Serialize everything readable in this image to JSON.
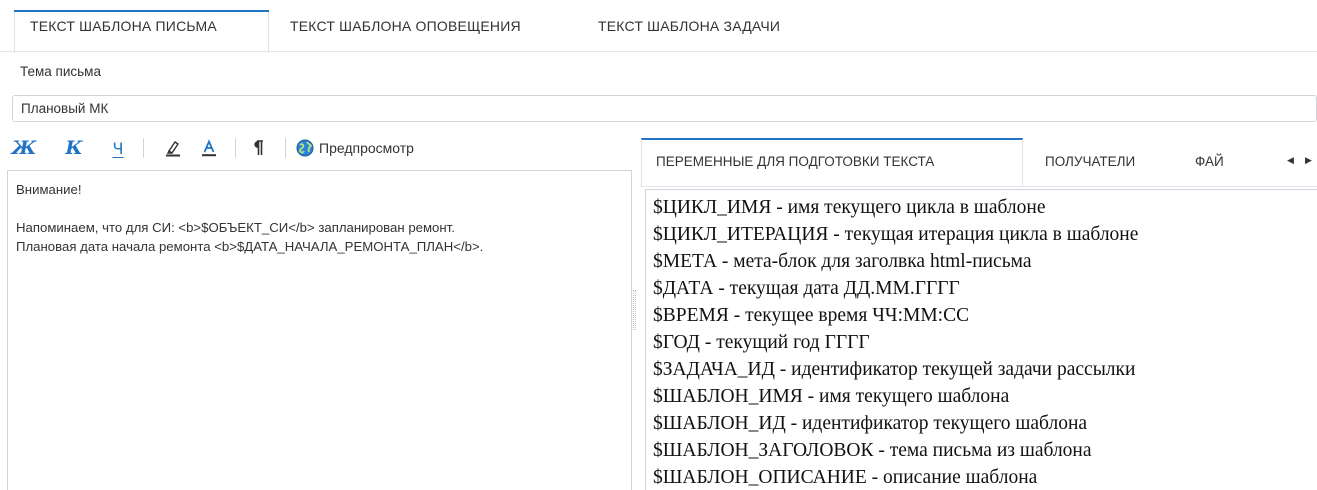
{
  "top_tabs": [
    {
      "label": "ТЕКСТ ШАБЛОНА ПИСЬМА",
      "active": true
    },
    {
      "label": "ТЕКСТ ШАБЛОНА ОПОВЕЩЕНИЯ",
      "active": false
    },
    {
      "label": "ТЕКСТ ШАБЛОНА ЗАДАЧИ",
      "active": false
    }
  ],
  "subject": {
    "label": "Тема письма",
    "value": "Плановый МК"
  },
  "toolbar": {
    "bold_label": "Ж",
    "italic_label": "К",
    "underline_label": "Ч",
    "preview_label": "Предпросмотр",
    "icons": [
      "bold-icon",
      "italic-icon",
      "underline-icon",
      "highlight-icon",
      "text-color-icon",
      "pilcrow-icon",
      "globe-icon"
    ],
    "accent_color": "#1f74c4"
  },
  "editor": {
    "content": "Внимание!\n\nНапоминаем, что для СИ: <b>$ОБЪЕКТ_СИ</b> запланирован ремонт.\nПлановая дата начала ремонта <b>$ДАТА_НАЧАЛА_РЕМОНТА_ПЛАН</b>."
  },
  "right_tabs": [
    {
      "label": "ПЕРЕМЕННЫЕ ДЛЯ ПОДГОТОВКИ ТЕКСТА",
      "active": true
    },
    {
      "label": "ПОЛУЧАТЕЛИ",
      "active": false
    },
    {
      "label": "ФАЙ",
      "active": false
    }
  ],
  "tab_scroll": {
    "left": "◀",
    "right": "▶"
  },
  "variables": [
    "$ЦИКЛ_ИМЯ - имя текущего цикла в шаблоне",
    "$ЦИКЛ_ИТЕРАЦИЯ - текущая итерация цикла в шаблоне",
    "$МЕТА - мета-блок для заголвка html-письма",
    "$ДАТА - текущая дата ДД.ММ.ГГГГ",
    "$ВРЕМЯ - текущее время ЧЧ:ММ:СС",
    "$ГОД - текущий год ГГГГ",
    "$ЗАДАЧА_ИД - идентификатор текущей задачи рассылки",
    "$ШАБЛОН_ИМЯ - имя текущего шаблона",
    "$ШАБЛОН_ИД - идентификатор текущего шаблона",
    "$ШАБЛОН_ЗАГОЛОВОК - тема письма из шаблона",
    "$ШАБЛОН_ОПИСАНИЕ - описание шаблона"
  ]
}
